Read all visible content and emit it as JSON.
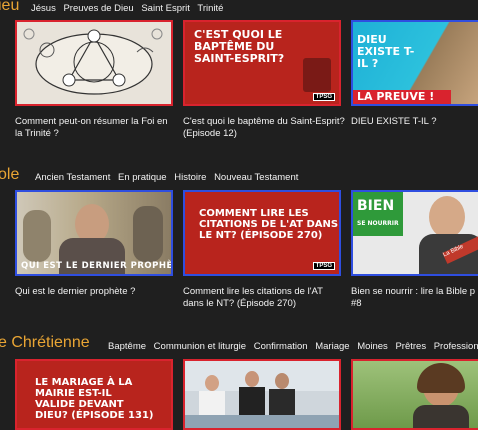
{
  "sections": [
    {
      "title": "ieu",
      "tags": [
        "Jésus",
        "Preuves de Dieu",
        "Saint Esprit",
        "Trinité"
      ],
      "cards": [
        {
          "caption": "Comment peut-on résumer la Foi en la Trinité ?"
        },
        {
          "caption": "C'est quoi le baptême du Saint-Esprit? (Episode 12)",
          "thumb_text": "C'EST QUOI LE BAPTÊME DU SAINT-ESPRIT?",
          "badge": "TPSG"
        },
        {
          "caption": "DIEU EXISTE T-IL ?",
          "thumb_text": "DIEU EXISTE T-IL ?",
          "thumb_text2": "LA PREUVE !"
        }
      ]
    },
    {
      "title": "ole",
      "tags": [
        "Ancien Testament",
        "En pratique",
        "Histoire",
        "Nouveau Testament"
      ],
      "cards": [
        {
          "caption": "Qui est le dernier prophète ?",
          "thumb_text": "QUI EST LE DERNIER PROPHÈTE ?"
        },
        {
          "caption": "Comment lire les citations de l'AT dans le NT? (Épisode 270)",
          "thumb_text": "COMMENT LIRE LES CITATIONS DE L'AT DANS LE NT? (ÉPISODE 270)",
          "badge": "TPSG"
        },
        {
          "caption": "Bien se nourrir : lire la Bible p #8",
          "thumb_text": "BIEN",
          "thumb_text2": "SE NOURRIR",
          "thumb_text3": "La Bible"
        }
      ]
    },
    {
      "title": "e Chrétienne",
      "tags": [
        "Baptême",
        "Communion et liturgie",
        "Confirmation",
        "Mariage",
        "Moines",
        "Prêtres",
        "Profession c"
      ],
      "cards": [
        {
          "thumb_text": "LE MARIAGE À LA MAIRIE EST-IL VALIDE DEVANT DIEU? (ÉPISODE 131)"
        },
        {},
        {}
      ]
    }
  ]
}
